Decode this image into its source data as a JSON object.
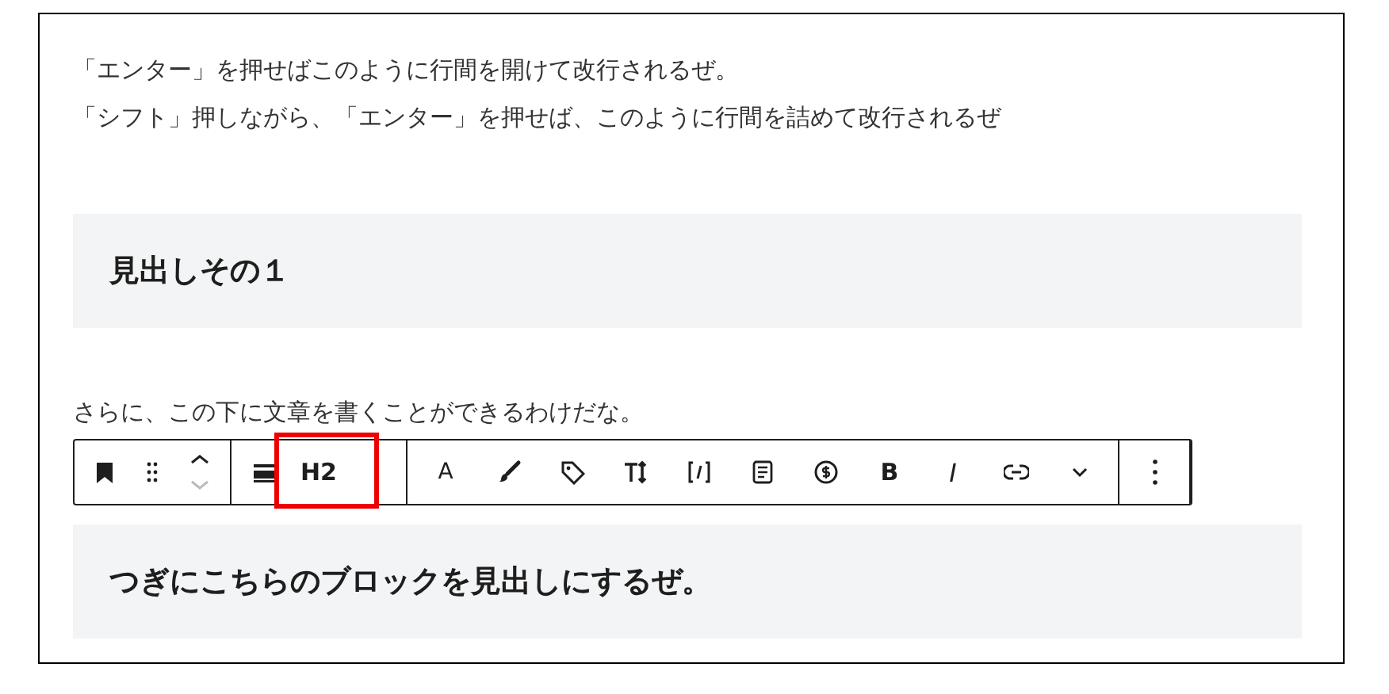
{
  "paragraphs_top": [
    "「エンター」を押せばこのように行間を開けて改行されるぜ。",
    "「シフト」押しながら、「エンター」を押せば、このように行間を詰めて改行されるぜ"
  ],
  "heading_1": "見出しその１",
  "paragraph": "さらに、この下に文章を書くことができるわけだな。",
  "toolbar": {
    "heading_level": "H2",
    "highlighted": true,
    "text_color": "A",
    "bold": "B",
    "italic": "I"
  },
  "heading_2": "つぎにこちらのブロックを見出しにするぜ。"
}
